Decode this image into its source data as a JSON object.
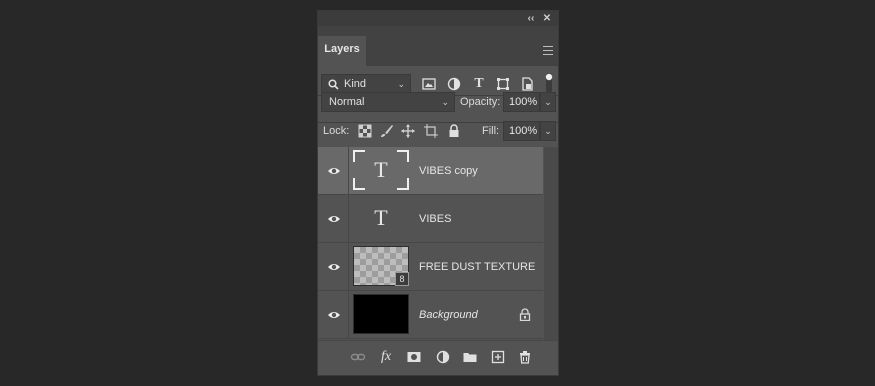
{
  "panel": {
    "title_controls": {
      "collapse": "‹‹",
      "close": "✕"
    },
    "tab": "Layers"
  },
  "filter": {
    "kind_label": "Kind",
    "icons": [
      "image-filter-icon",
      "adjustment-filter-icon",
      "type-filter-icon",
      "shape-filter-icon",
      "smart-object-filter-icon"
    ]
  },
  "blend": {
    "mode": "Normal",
    "opacity_label": "Opacity:",
    "opacity_value": "100%"
  },
  "lock": {
    "label": "Lock:",
    "fill_label": "Fill:",
    "fill_value": "100%"
  },
  "layers": [
    {
      "name": "VIBES copy",
      "type": "text",
      "selected": true,
      "thumb_glyph": "T"
    },
    {
      "name": "VIBES",
      "type": "text",
      "selected": false,
      "thumb_glyph": "T"
    },
    {
      "name": "FREE DUST TEXTURE",
      "type": "smart-object",
      "selected": false
    },
    {
      "name": "Background",
      "type": "background",
      "selected": false,
      "locked": true
    }
  ],
  "bottom_icons": [
    "link-layers-icon",
    "fx-icon",
    "layer-mask-icon",
    "adjustment-layer-icon",
    "new-group-icon",
    "new-layer-icon",
    "delete-layer-icon"
  ],
  "bottom_fx": "fx"
}
